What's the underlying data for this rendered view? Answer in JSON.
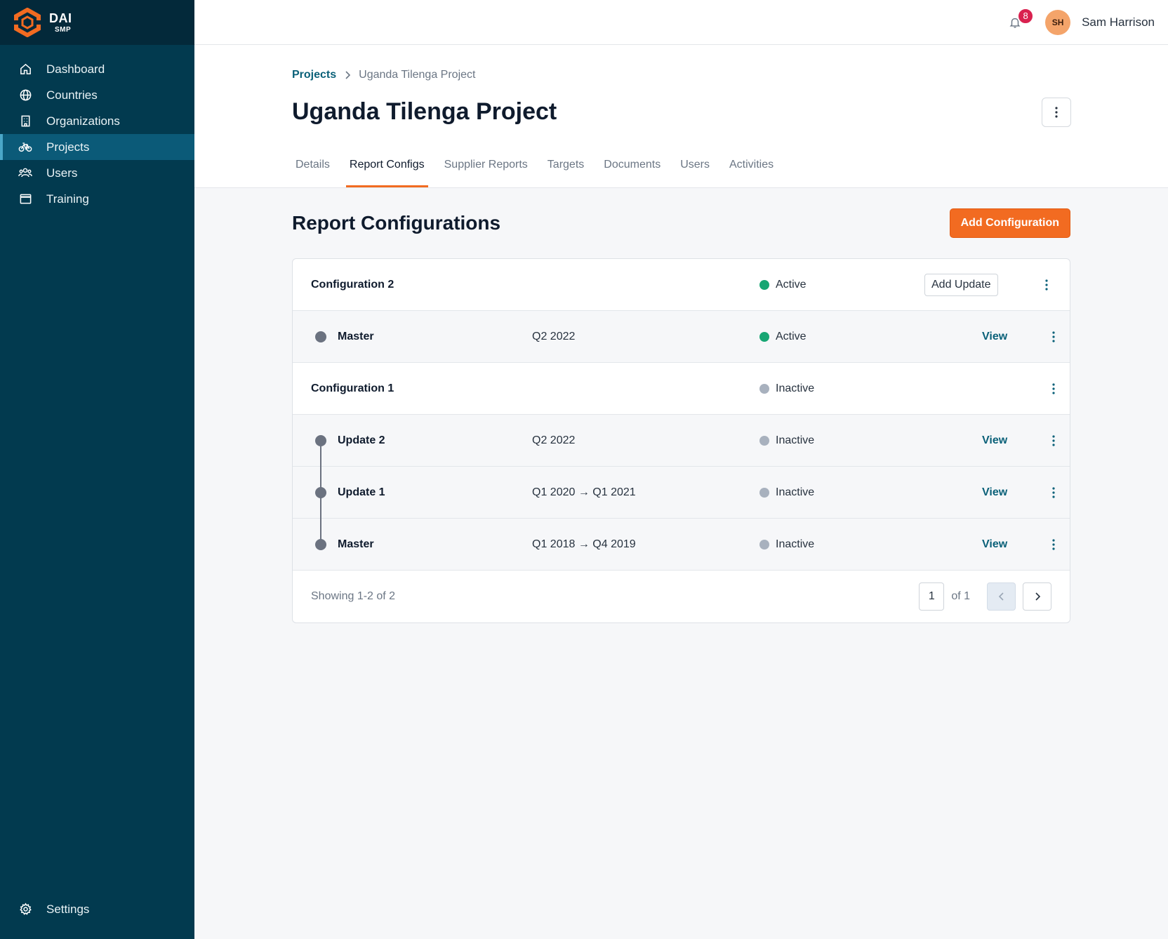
{
  "brand": {
    "name": "DAI",
    "sub": "SMP"
  },
  "sidebar": {
    "items": [
      {
        "label": "Dashboard",
        "icon": "home-icon"
      },
      {
        "label": "Countries",
        "icon": "globe-icon"
      },
      {
        "label": "Organizations",
        "icon": "building-icon"
      },
      {
        "label": "Projects",
        "icon": "bicycle-icon",
        "active": true
      },
      {
        "label": "Users",
        "icon": "users-icon"
      },
      {
        "label": "Training",
        "icon": "window-icon"
      }
    ],
    "settings_label": "Settings"
  },
  "topbar": {
    "notification_count": "8",
    "avatar_initials": "SH",
    "user_name": "Sam Harrison"
  },
  "breadcrumb": {
    "parent": "Projects",
    "current": "Uganda Tilenga Project"
  },
  "page": {
    "title": "Uganda Tilenga Project"
  },
  "tabs": [
    {
      "label": "Details"
    },
    {
      "label": "Report Configs",
      "active": true
    },
    {
      "label": "Supplier Reports"
    },
    {
      "label": "Targets"
    },
    {
      "label": "Documents"
    },
    {
      "label": "Users"
    },
    {
      "label": "Activities"
    }
  ],
  "section": {
    "title": "Report Configurations",
    "add_button": "Add Configuration"
  },
  "configs": {
    "cfg2": {
      "name": "Configuration 2",
      "status": "Active",
      "add_update_label": "Add Update"
    },
    "cfg2_master": {
      "name": "Master",
      "period": "Q2 2022",
      "status": "Active",
      "view": "View"
    },
    "cfg1": {
      "name": "Configuration 1",
      "status": "Inactive"
    },
    "cfg1_update2": {
      "name": "Update 2",
      "period": "Q2 2022",
      "status": "Inactive",
      "view": "View"
    },
    "cfg1_update1": {
      "name": "Update 1",
      "period": "Q1 2020 → Q1 2021",
      "status": "Inactive",
      "view": "View"
    },
    "cfg1_master": {
      "name": "Master",
      "period": "Q1 2018 → Q4 2019",
      "status": "Inactive",
      "view": "View"
    }
  },
  "pagination": {
    "showing": "Showing 1-2 of 2",
    "page": "1",
    "of": "of 1"
  },
  "colors": {
    "sidebar": "#023a4f",
    "accent": "#f26b21",
    "link": "#0b6179",
    "active_status": "#17a673",
    "inactive_status": "#a8b1be"
  }
}
